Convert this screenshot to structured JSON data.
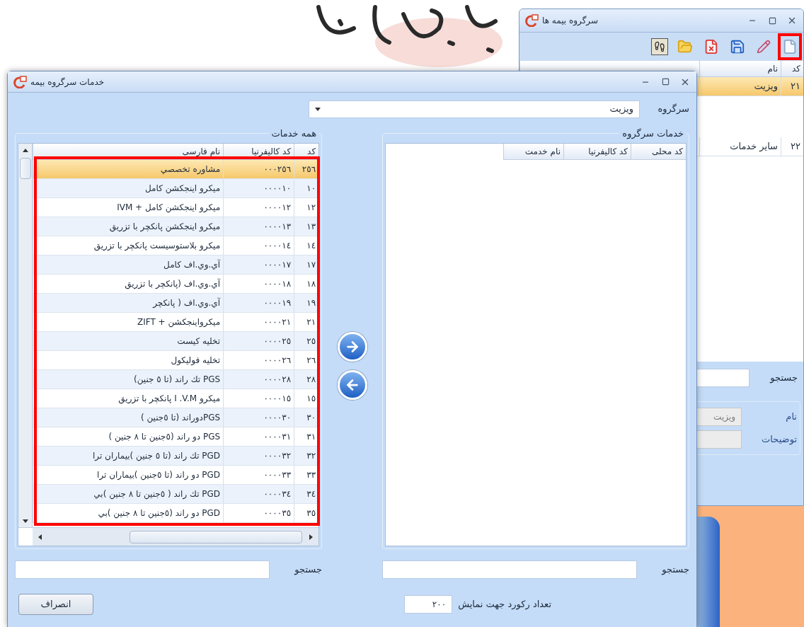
{
  "back_window": {
    "title": "سرگروه بیمه ها",
    "table": {
      "columns": [
        "کد",
        "نام"
      ],
      "rows": [
        {
          "cells": [
            "٢١",
            "ویزیت"
          ],
          "selected": true
        },
        {
          "cells": [
            "٢٢",
            "سایر خدمات"
          ],
          "selected": false
        }
      ]
    },
    "search": {
      "label": "جستجو"
    },
    "form": [
      {
        "label": "نام",
        "value": "ویزیت",
        "disabled": true
      },
      {
        "label": "توضیحات",
        "disabled": true
      }
    ]
  },
  "dialog": {
    "title": "خدمات سرگروه بیمه",
    "group_field": {
      "label": "سرگروه",
      "value": "ویزیت"
    },
    "group_services": {
      "title": "خدمات سرگروه",
      "columns": [
        "کد محلی",
        "کد کالیفرنیا",
        "نام خدمت"
      ]
    },
    "all_services": {
      "title": "همه خدمات",
      "columns": [
        "کد",
        "کد کالیفرنیا",
        "نام فارسی"
      ],
      "rows": [
        {
          "cells": [
            "٢٥٦",
            "٠٠٠٢٥٦",
            "مشاوره  تخصصي"
          ],
          "selected": true
        },
        {
          "cells": [
            "١٠",
            "٠٠٠٠١٠",
            "ميكرو  اينجكشن  كامل"
          ],
          "selected": false
        },
        {
          "cells": [
            "١٢",
            "٠٠٠٠١٢",
            "ميكرو  اينجكشن كامل + IVM"
          ],
          "selected": false
        },
        {
          "cells": [
            "١٣",
            "٠٠٠٠١٣",
            "ميكرو  اينجكشن پانكچر با تزريق"
          ],
          "selected": false
        },
        {
          "cells": [
            "١٤",
            "٠٠٠٠١٤",
            "ميكرو بلاستوسيست پانكچر با تزريق"
          ],
          "selected": false
        },
        {
          "cells": [
            "١٧",
            "٠٠٠٠١٧",
            "آي.وي.اف كامل"
          ],
          "selected": false
        },
        {
          "cells": [
            "١٨",
            "٠٠٠٠١٨",
            "آي.وي.اف (پانكچر با تزريق"
          ],
          "selected": false
        },
        {
          "cells": [
            "١٩",
            "٠٠٠٠١٩",
            "آي.وي.اف ( پانكچر"
          ],
          "selected": false
        },
        {
          "cells": [
            "٢١",
            "٠٠٠٠٢١",
            "ميكرواينجكشن  + ZIFT"
          ],
          "selected": false
        },
        {
          "cells": [
            "٢٥",
            "٠٠٠٠٢٥",
            "تخليه كيست"
          ],
          "selected": false
        },
        {
          "cells": [
            "٢٦",
            "٠٠٠٠٢٦",
            "تخليه فوليكول"
          ],
          "selected": false
        },
        {
          "cells": [
            "٢٨",
            "٠٠٠٠٢٨",
            "PGS  تك راند (تا ٥ جنين)"
          ],
          "selected": false
        },
        {
          "cells": [
            "١٥",
            "٠٠٠٠١٥",
            "ميكرو   I .V.M  پانكچر با تزريق"
          ],
          "selected": false
        },
        {
          "cells": [
            "٣٠",
            "٠٠٠٠٣٠",
            "PGSدوراند (تا ٥جنين )"
          ],
          "selected": false
        },
        {
          "cells": [
            "٣١",
            "٠٠٠٠٣١",
            "PGS  دو راند (٥جنين تا ٨ جنين )"
          ],
          "selected": false
        },
        {
          "cells": [
            "٣٢",
            "٠٠٠٠٣٢",
            "PGD تك راند (تا ٥ جنين )بيماران ترا"
          ],
          "selected": false
        },
        {
          "cells": [
            "٣٣",
            "٠٠٠٠٣٣",
            "PGD دو راند (تا ٥جنين )بيماران ترا"
          ],
          "selected": false
        },
        {
          "cells": [
            "٣٤",
            "٠٠٠٠٣٤",
            "PGD تك راند ( ٥جنين تا ٨ جنين )بي"
          ],
          "selected": false
        },
        {
          "cells": [
            "٣٥",
            "٠٠٠٠٣٥",
            "PGD دو راند (٥جنين تا ٨ جنين )بي"
          ],
          "selected": false
        }
      ]
    },
    "search_right": {
      "label": "جستجو"
    },
    "search_left": {
      "label": "جستجو"
    },
    "record_count": {
      "label": "تعداد رکورد جهت نمایش",
      "value": "٢٠٠"
    },
    "cancel_button": "انصراف"
  }
}
